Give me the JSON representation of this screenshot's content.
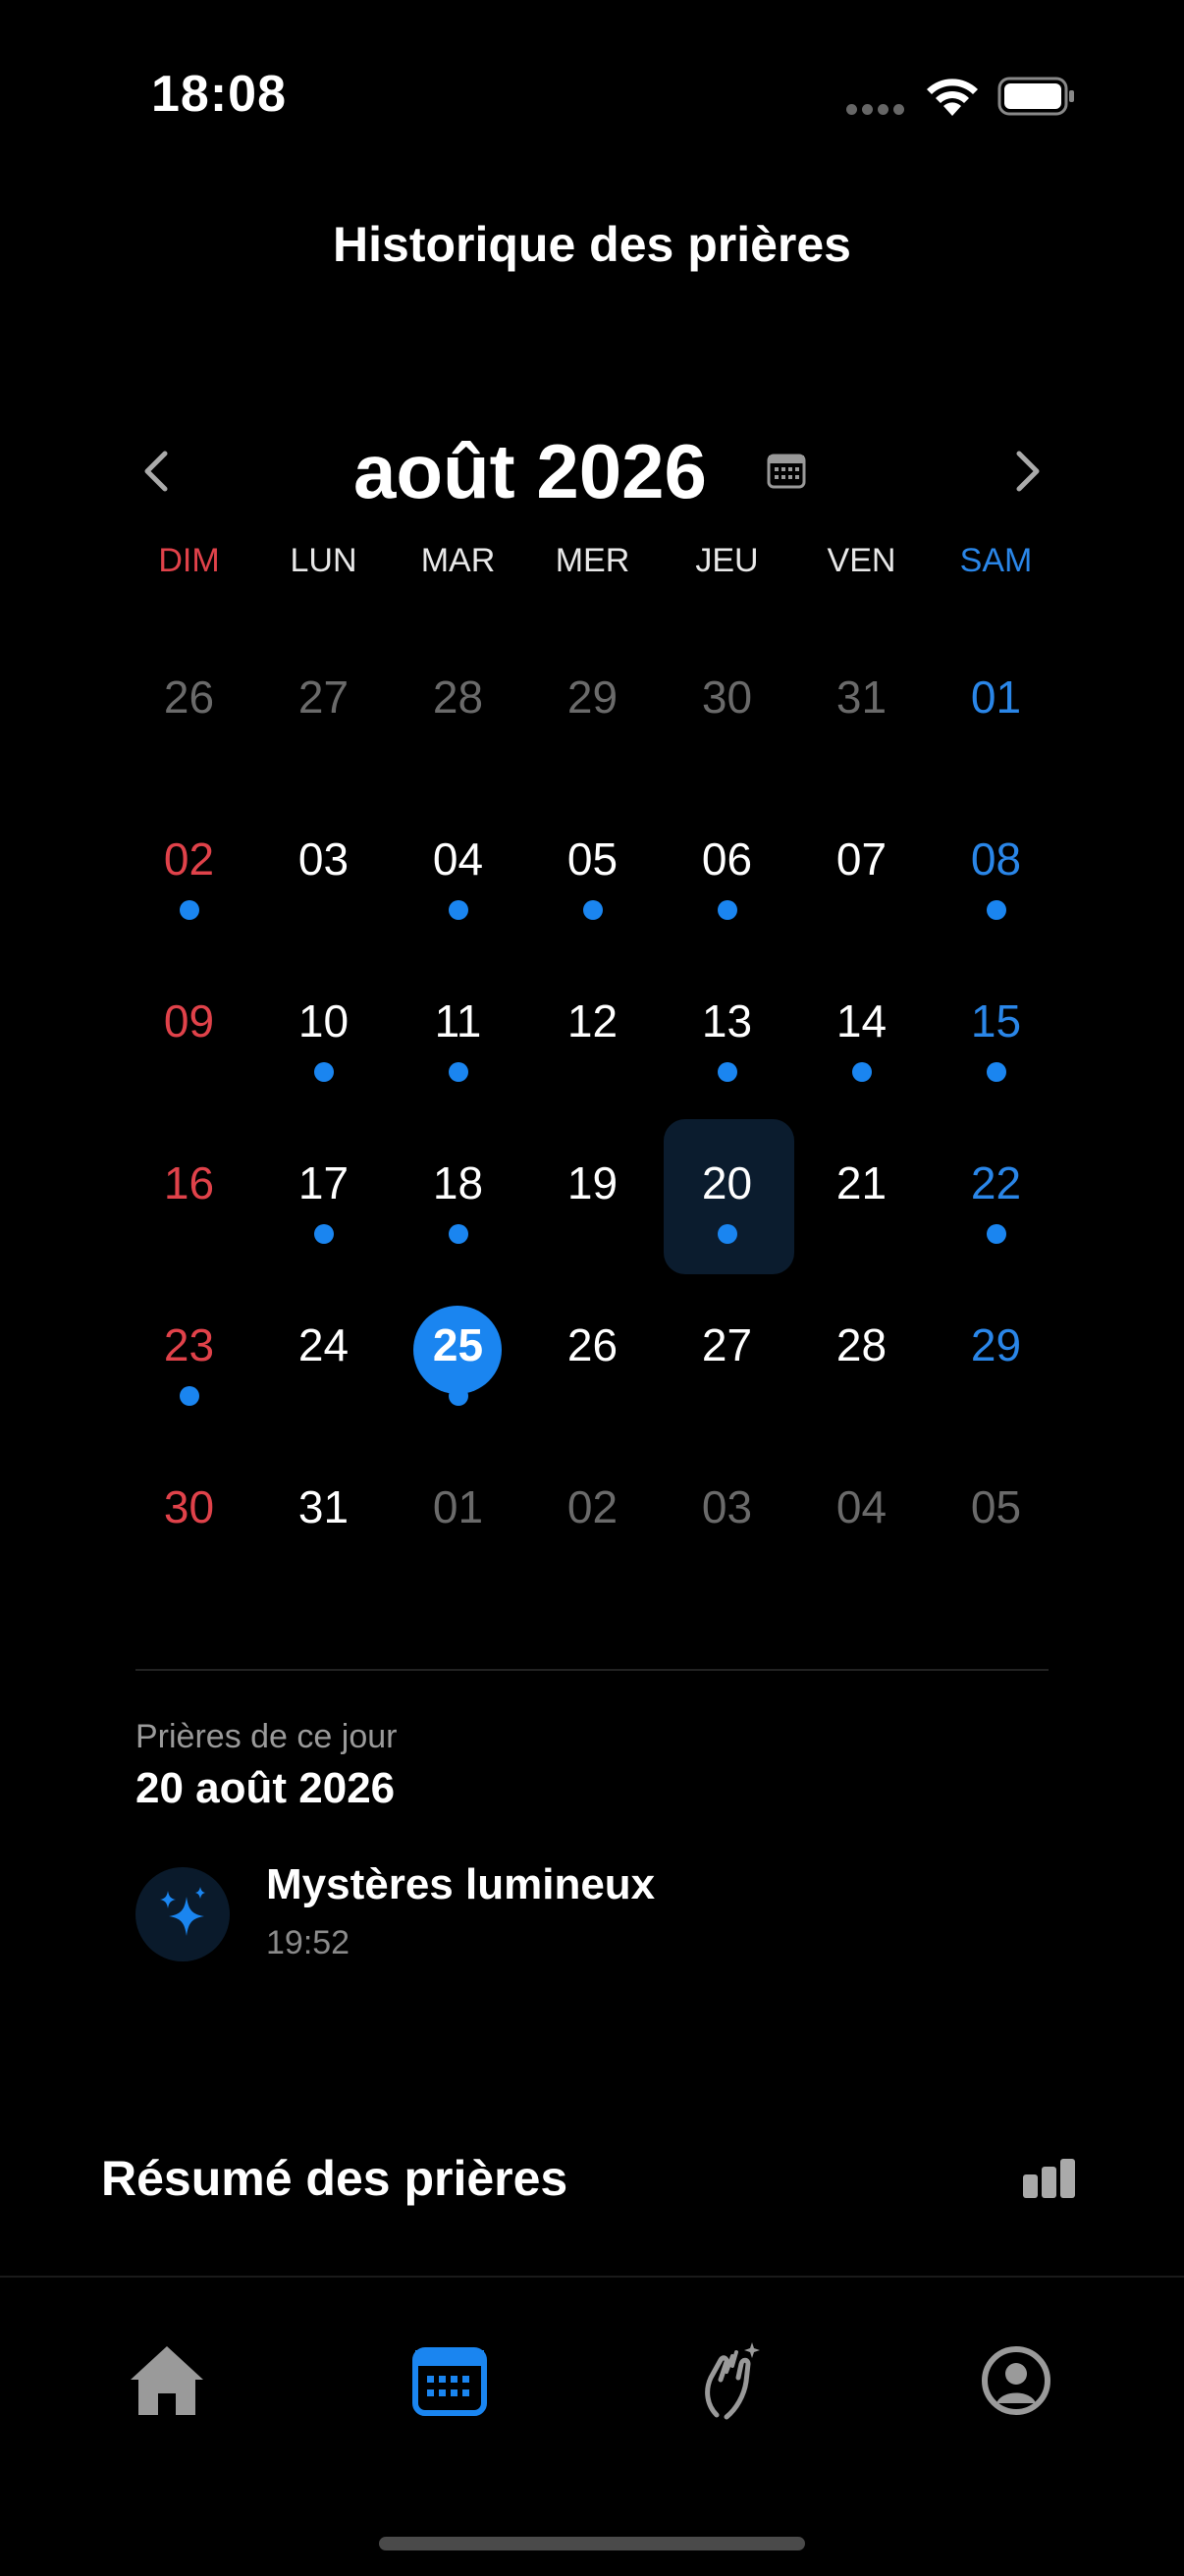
{
  "status_bar": {
    "time": "18:08"
  },
  "header": {
    "title": "Historique des prières"
  },
  "calendar": {
    "month_label": "août 2026",
    "weekdays": [
      "DIM",
      "LUN",
      "MAR",
      "MER",
      "JEU",
      "VEN",
      "SAM"
    ],
    "weeks": [
      [
        {
          "d": "26",
          "other": true
        },
        {
          "d": "27",
          "other": true
        },
        {
          "d": "28",
          "other": true
        },
        {
          "d": "29",
          "other": true
        },
        {
          "d": "30",
          "other": true
        },
        {
          "d": "31",
          "other": true
        },
        {
          "d": "01"
        }
      ],
      [
        {
          "d": "02",
          "dot": true
        },
        {
          "d": "03"
        },
        {
          "d": "04",
          "dot": true
        },
        {
          "d": "05",
          "dot": true
        },
        {
          "d": "06",
          "dot": true
        },
        {
          "d": "07"
        },
        {
          "d": "08",
          "dot": true
        }
      ],
      [
        {
          "d": "09"
        },
        {
          "d": "10",
          "dot": true
        },
        {
          "d": "11",
          "dot": true
        },
        {
          "d": "12"
        },
        {
          "d": "13",
          "dot": true
        },
        {
          "d": "14",
          "dot": true
        },
        {
          "d": "15",
          "dot": true
        }
      ],
      [
        {
          "d": "16"
        },
        {
          "d": "17",
          "dot": true
        },
        {
          "d": "18",
          "dot": true
        },
        {
          "d": "19"
        },
        {
          "d": "20",
          "dot": true,
          "selected": true
        },
        {
          "d": "21"
        },
        {
          "d": "22",
          "dot": true
        }
      ],
      [
        {
          "d": "23",
          "dot": true
        },
        {
          "d": "24"
        },
        {
          "d": "25",
          "dot": true,
          "today": true
        },
        {
          "d": "26"
        },
        {
          "d": "27"
        },
        {
          "d": "28"
        },
        {
          "d": "29"
        }
      ],
      [
        {
          "d": "30"
        },
        {
          "d": "31"
        },
        {
          "d": "01",
          "other": true
        },
        {
          "d": "02",
          "other": true
        },
        {
          "d": "03",
          "other": true
        },
        {
          "d": "04",
          "other": true
        },
        {
          "d": "05",
          "other": true
        }
      ]
    ]
  },
  "day_detail": {
    "label": "Prières de ce jour",
    "date": "20 août 2026",
    "prayers": [
      {
        "name": "Mystères lumineux",
        "time": "19:52",
        "icon": "sparkles-icon"
      }
    ]
  },
  "summary": {
    "title": "Résumé des prières",
    "icon": "bar-chart-icon"
  },
  "tabbar": {
    "items": [
      {
        "name": "home",
        "icon": "house-icon",
        "active": false
      },
      {
        "name": "history",
        "icon": "calendar-icon",
        "active": true
      },
      {
        "name": "pray",
        "icon": "praying-hands-icon",
        "active": false
      },
      {
        "name": "profile",
        "icon": "person-circle-icon",
        "active": false
      }
    ]
  },
  "colors": {
    "accent": "#1A85F0",
    "sunday": "#E0424A",
    "saturday": "#2A86E8",
    "muted": "#6A6A6A"
  }
}
